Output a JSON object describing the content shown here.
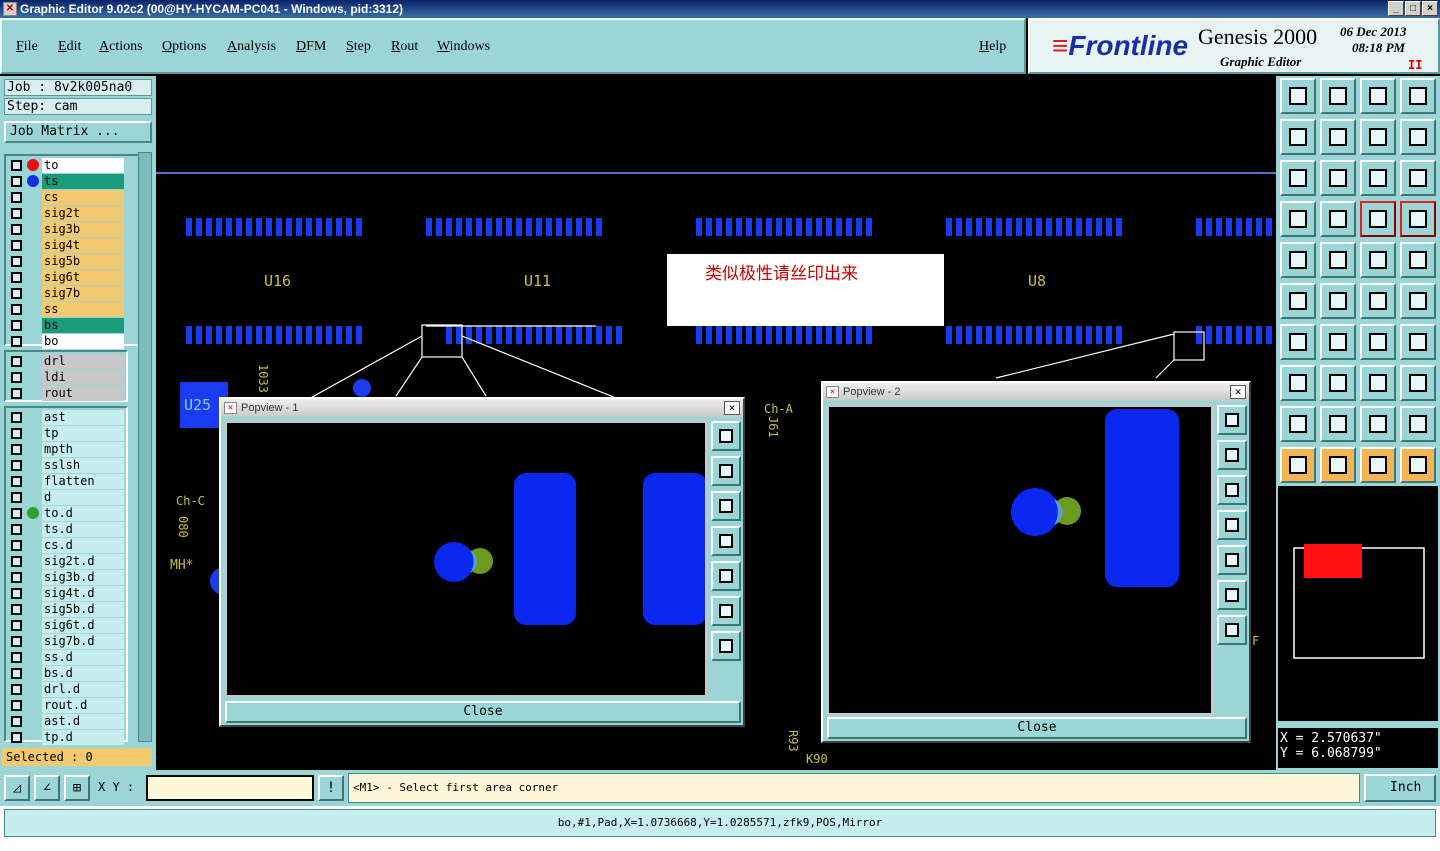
{
  "window": {
    "title": "Graphic Editor 9.02c2 (00@HY-HYCAM-PC041 - Windows, pid:3312)",
    "icon": "x-app-icon",
    "controls": [
      "_",
      "□",
      "×"
    ]
  },
  "menu": {
    "items": [
      "File",
      "Edit",
      "Actions",
      "Options",
      "Analysis",
      "DFM",
      "Step",
      "Rout",
      "Windows"
    ],
    "help": "Help"
  },
  "brand": {
    "logo_prefix": "≡",
    "logo": "Frontline",
    "product": "Genesis 2000",
    "subtitle": "Graphic Editor",
    "date": "06 Dec 2013",
    "time": "08:18 PM",
    "pause": "II"
  },
  "job": {
    "job_label": "Job : 8v2k005na0",
    "step_label": "Step: cam",
    "matrix_button": "Job Matrix ..."
  },
  "layers_top": [
    {
      "name": "to",
      "color": "#ffffff",
      "dot": "#e81010"
    },
    {
      "name": "ts",
      "color": "#1a9b7c",
      "dot": "#1030e0"
    },
    {
      "name": "cs",
      "color": "#f3c970"
    },
    {
      "name": "sig2t",
      "color": "#f3c970"
    },
    {
      "name": "sig3b",
      "color": "#f3c970"
    },
    {
      "name": "sig4t",
      "color": "#f3c970"
    },
    {
      "name": "sig5b",
      "color": "#f3c970"
    },
    {
      "name": "sig6t",
      "color": "#f3c970"
    },
    {
      "name": "sig7b",
      "color": "#f3c970"
    },
    {
      "name": "ss",
      "color": "#f3c970"
    },
    {
      "name": "bs",
      "color": "#1a9b7c"
    },
    {
      "name": "bo",
      "color": "#ffffff"
    }
  ],
  "layers_mid": [
    {
      "name": "drl",
      "color": "#c8c8c8"
    },
    {
      "name": "ldi",
      "color": "#c8c8c8"
    },
    {
      "name": "rout",
      "color": "#c8c8c8"
    }
  ],
  "layers_bot": [
    {
      "name": "ast"
    },
    {
      "name": "tp"
    },
    {
      "name": "mpth"
    },
    {
      "name": "sslsh"
    },
    {
      "name": "flatten"
    },
    {
      "name": "d"
    },
    {
      "name": "to.d",
      "dot": "#30a030"
    },
    {
      "name": "ts.d"
    },
    {
      "name": "cs.d"
    },
    {
      "name": "sig2t.d"
    },
    {
      "name": "sig3b.d"
    },
    {
      "name": "sig4t.d"
    },
    {
      "name": "sig5b.d"
    },
    {
      "name": "sig6t.d"
    },
    {
      "name": "sig7b.d"
    },
    {
      "name": "ss.d"
    },
    {
      "name": "bs.d"
    },
    {
      "name": "drl.d"
    },
    {
      "name": "rout.d"
    },
    {
      "name": "ast.d"
    },
    {
      "name": "tp.d"
    }
  ],
  "selected": "Selected : 0",
  "canvas": {
    "note": "类似极性请丝印出来",
    "labels": [
      "U16",
      "U11",
      "U8",
      "U25",
      "Ch-A",
      "Ch-C",
      "MH*",
      "080",
      "1033",
      "J61",
      "R93",
      "K90",
      "F"
    ]
  },
  "popview1": {
    "title": "Popview - 1",
    "close": "Close"
  },
  "popview2": {
    "title": "Popview - 2",
    "close": "Close"
  },
  "coords": {
    "x": "X = 2.570637\"",
    "y": "Y = 6.068799\""
  },
  "bottom": {
    "xy_label": "X Y :",
    "xy_value": "",
    "alert": "!",
    "prompt": "<M1> - Select first area corner",
    "unit": "Inch"
  },
  "status": "bo,#1,Pad,X=1.0736668,Y=1.0285571,zfk9,POS,Mirror"
}
